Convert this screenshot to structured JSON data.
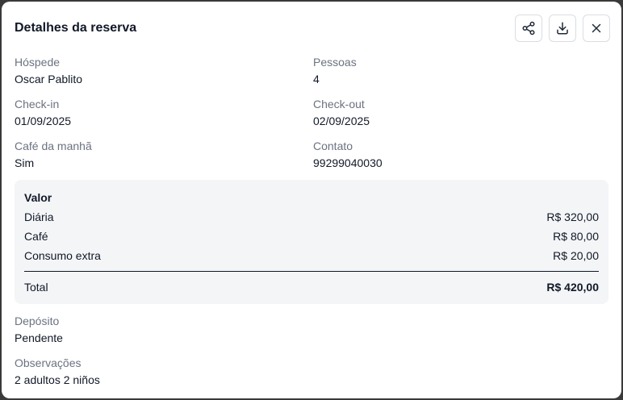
{
  "modal": {
    "title": "Detalhes da reserva",
    "actions": {
      "share_icon": "share-icon",
      "download_icon": "download-icon",
      "close_icon": "close-icon"
    }
  },
  "details": {
    "guest_label": "Hóspede",
    "guest_value": "Oscar Pablito",
    "people_label": "Pessoas",
    "people_value": "4",
    "checkin_label": "Check-in",
    "checkin_value": "01/09/2025",
    "checkout_label": "Check-out",
    "checkout_value": "02/09/2025",
    "breakfast_label": "Café da manhã",
    "breakfast_value": "Sim",
    "contact_label": "Contato",
    "contact_value": "99299040030"
  },
  "summary": {
    "title": "Valor",
    "items": [
      {
        "label": "Diária",
        "amount": "R$ 320,00"
      },
      {
        "label": "Café",
        "amount": "R$ 80,00"
      },
      {
        "label": "Consumo extra",
        "amount": "R$ 20,00"
      }
    ],
    "total_label": "Total",
    "total_amount": "R$ 420,00"
  },
  "deposit": {
    "label": "Depósito",
    "value": "Pendente"
  },
  "notes": {
    "label": "Observações",
    "value": "2 adultos 2 niños"
  }
}
